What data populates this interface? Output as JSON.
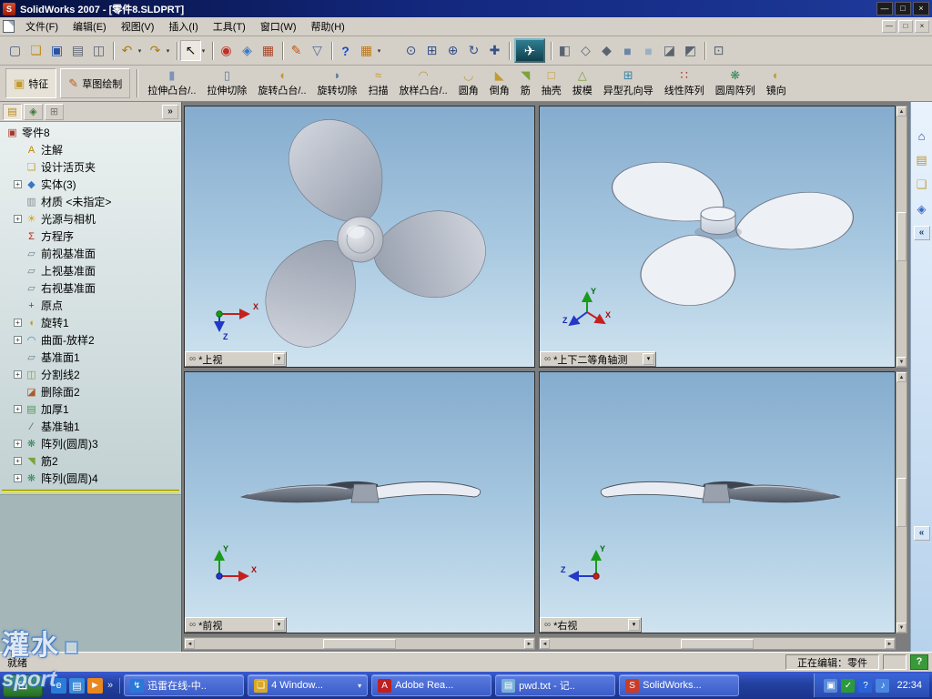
{
  "colors": {
    "titlebar": "#13277d",
    "panel": "#d4d0c8",
    "viewport_top": "#85acce",
    "viewport_bottom": "#cfe3ef",
    "taskbar": "#22409e",
    "rollback": "#ece800"
  },
  "window": {
    "title": "SolidWorks 2007 - [零件8.SLDPRT]",
    "min_glyph": "—",
    "restore_glyph": "□",
    "close_glyph": "×"
  },
  "menu": {
    "items": [
      "文件(F)",
      "编辑(E)",
      "视图(V)",
      "插入(I)",
      "工具(T)",
      "窗口(W)",
      "帮助(H)"
    ]
  },
  "toolbar": {
    "items": [
      {
        "n": "new-document-icon",
        "g": "▢",
        "c": "#46587e"
      },
      {
        "n": "open-folder-icon",
        "g": "❏",
        "c": "#c09020"
      },
      {
        "n": "save-icon",
        "g": "▣",
        "c": "#2a52a8"
      },
      {
        "n": "print-icon",
        "g": "▤",
        "c": "#5a6470"
      },
      {
        "n": "print-preview-icon",
        "g": "◫",
        "c": "#5a6470"
      },
      {
        "n": "toolbar-separator",
        "cls": "sep",
        "inter": "false"
      },
      {
        "n": "undo-icon",
        "g": "↶",
        "c": "#a87e10"
      },
      {
        "n": "dropdown-caret-icon",
        "g": "▾",
        "c": "#333333",
        "cls": "caretbtn"
      },
      {
        "n": "redo-icon",
        "g": "↷",
        "c": "#a87e10"
      },
      {
        "n": "dropdown-caret-icon",
        "g": "▾",
        "c": "#333333",
        "cls": "caretbtn"
      },
      {
        "n": "toolbar-separator",
        "cls": "sep",
        "inter": "false"
      },
      {
        "n": "select-arrow-icon",
        "g": "↖",
        "c": "#101010",
        "cls": "pressed"
      },
      {
        "n": "dropdown-caret-icon",
        "g": "▾",
        "c": "#333333",
        "cls": "caretbtn"
      },
      {
        "n": "toolbar-separator",
        "cls": "sep",
        "inter": "false"
      },
      {
        "n": "rebuild-icon",
        "g": "◉",
        "c": "#c03028"
      },
      {
        "n": "edit-color-icon",
        "g": "◈",
        "c": "#3a7ac0"
      },
      {
        "n": "texture-icon",
        "g": "▦",
        "c": "#a8462a"
      },
      {
        "n": "toolbar-separator",
        "cls": "sep",
        "inter": "false"
      },
      {
        "n": "sketch-icon",
        "g": "✎",
        "c": "#b85a1a"
      },
      {
        "n": "selection-filter-icon",
        "g": "▽",
        "c": "#50689a"
      },
      {
        "n": "toolbar-separator",
        "cls": "sep",
        "inter": "false"
      },
      {
        "n": "help-icon",
        "g": "?",
        "c": "#1a4ac8",
        "cls": "bold"
      },
      {
        "n": "design-table-icon",
        "g": "▦",
        "c": "#c07818"
      },
      {
        "n": "dropdown-caret-icon",
        "g": "▾",
        "c": "#333333",
        "cls": "caretbtn"
      },
      {
        "n": "toolbar-gap",
        "cls": "gap",
        "inter": "false"
      },
      {
        "n": "zoom-to-fit-icon",
        "g": "⊙",
        "c": "#35508a"
      },
      {
        "n": "zoom-area-icon",
        "g": "⊞",
        "c": "#35508a"
      },
      {
        "n": "zoom-in-out-icon",
        "g": "⊕",
        "c": "#35508a"
      },
      {
        "n": "rotate-view-icon",
        "g": "↻",
        "c": "#35508a"
      },
      {
        "n": "pan-icon",
        "g": "✚",
        "c": "#35508a"
      },
      {
        "n": "toolbar-separator",
        "cls": "sep",
        "inter": "false"
      },
      {
        "n": "plugin-button",
        "g": "✈",
        "c": "#ffffff",
        "cls": "plugin"
      },
      {
        "n": "toolbar-separator",
        "cls": "sep",
        "inter": "false"
      },
      {
        "n": "view-orientation-icon",
        "g": "◧",
        "c": "#5a6470"
      },
      {
        "n": "wireframe-icon",
        "g": "◇",
        "c": "#5a6470"
      },
      {
        "n": "hidden-lines-removed-icon",
        "g": "◆",
        "c": "#5a6470"
      },
      {
        "n": "shaded-with-edges-icon",
        "g": "■",
        "c": "#6a86a8"
      },
      {
        "n": "shaded-icon",
        "g": "■",
        "c": "#9ab0c4"
      },
      {
        "n": "shadows-icon",
        "g": "◪",
        "c": "#5a6470"
      },
      {
        "n": "section-view-icon",
        "g": "◩",
        "c": "#5a6470"
      },
      {
        "n": "toolbar-separator",
        "cls": "sep",
        "inter": "false"
      },
      {
        "n": "fullscreen-icon",
        "g": "⊡",
        "c": "#5a6470"
      }
    ]
  },
  "command_manager": {
    "tabs": [
      {
        "label": "特征",
        "icon": "features-tab-icon",
        "g": "▣",
        "c": "#c29a32",
        "cls": "active"
      },
      {
        "label": "草图绘制",
        "icon": "sketch-tab-icon",
        "g": "✎",
        "c": "#b85a1a"
      }
    ],
    "buttons": [
      {
        "label": "拉伸凸台/..",
        "icon": "boss-extrude-icon",
        "g": "▮",
        "c": "#7d94b6"
      },
      {
        "label": "拉伸切除",
        "icon": "cut-extrude-icon",
        "g": "▯",
        "c": "#5c7da0"
      },
      {
        "label": "旋转凸台/..",
        "icon": "revolve-boss-icon",
        "g": "◖",
        "c": "#c29a32"
      },
      {
        "label": "旋转切除",
        "icon": "revolve-cut-icon",
        "g": "◗",
        "c": "#5c7da0"
      },
      {
        "label": "扫描",
        "icon": "sweep-icon",
        "g": "≈",
        "c": "#c29a32"
      },
      {
        "label": "放样凸台/..",
        "icon": "loft-icon",
        "g": "◠",
        "c": "#c29a32"
      },
      {
        "label": "圆角",
        "icon": "fillet-icon",
        "g": "◡",
        "c": "#c29a32"
      },
      {
        "label": "倒角",
        "icon": "chamfer-icon",
        "g": "◣",
        "c": "#c29a32"
      },
      {
        "label": "筋",
        "icon": "rib-icon",
        "g": "◥",
        "c": "#7da23c"
      },
      {
        "label": "抽壳",
        "icon": "shell-icon",
        "g": "□",
        "c": "#c29a32"
      },
      {
        "label": "拔模",
        "icon": "draft-icon",
        "g": "△",
        "c": "#7da23c"
      },
      {
        "label": "异型孔向导",
        "icon": "hole-wizard-icon",
        "g": "⊞",
        "c": "#3a87a8"
      },
      {
        "label": "线性阵列",
        "icon": "linear-pattern-icon",
        "g": "∷",
        "c": "#a03828"
      },
      {
        "label": "圆周阵列",
        "icon": "circular-pattern-icon",
        "g": "❋",
        "c": "#3a8858"
      },
      {
        "label": "镜向",
        "icon": "mirror-icon",
        "g": "◐",
        "c": "#c29a32"
      }
    ]
  },
  "panel": {
    "tabs": [
      {
        "n": "featuremanager-tab",
        "g": "▤",
        "c": "#b8860b",
        "cls": "active"
      },
      {
        "n": "propertymanager-tab",
        "g": "◈",
        "c": "#3a7a3a"
      },
      {
        "n": "configurationmanager-tab",
        "g": "⊞",
        "c": "#777777"
      }
    ],
    "collapse_glyph": "»"
  },
  "feature_tree": {
    "root": "零件8",
    "root_glyph": "▣",
    "items": [
      {
        "label": "注解",
        "icon": "annotations-icon",
        "g": "A",
        "c": "#b8860b"
      },
      {
        "label": "设计活页夹",
        "icon": "design-binder-icon",
        "g": "❏",
        "c": "#c8a23c"
      },
      {
        "label": "实体(3)",
        "icon": "solid-bodies-folder-icon",
        "g": "◆",
        "c": "#3a76c4",
        "exp": "+"
      },
      {
        "label": "材质 <未指定>",
        "icon": "material-icon",
        "g": "▥",
        "c": "#8a8f96"
      },
      {
        "label": "光源与相机",
        "icon": "lights-cameras-icon",
        "g": "☀",
        "c": "#d8a018",
        "exp": "+"
      },
      {
        "label": "方程序",
        "icon": "equations-icon",
        "g": "Σ",
        "c": "#b03020"
      },
      {
        "label": "前视基准面",
        "icon": "front-plane-icon",
        "g": "▱",
        "c": "#6a7f94"
      },
      {
        "label": "上视基准面",
        "icon": "top-plane-icon",
        "g": "▱",
        "c": "#6a7f94"
      },
      {
        "label": "右视基准面",
        "icon": "right-plane-icon",
        "g": "▱",
        "c": "#6a7f94"
      },
      {
        "label": "原点",
        "icon": "origin-icon",
        "g": "+",
        "c": "#2a52c8"
      },
      {
        "label": "旋转1",
        "icon": "revolve-feature-icon",
        "g": "◖",
        "c": "#c29a32",
        "exp": "+"
      },
      {
        "label": "曲面-放样2",
        "icon": "surface-loft-icon",
        "g": "◠",
        "c": "#3a87c8",
        "exp": "+"
      },
      {
        "label": "基准面1",
        "icon": "plane-icon",
        "g": "▱",
        "c": "#6a7f94"
      },
      {
        "label": "分割线2",
        "icon": "split-line-icon",
        "g": "◫",
        "c": "#7da23c",
        "exp": "+"
      },
      {
        "label": "删除面2",
        "icon": "delete-face-icon",
        "g": "◪",
        "c": "#b05a28"
      },
      {
        "label": "加厚1",
        "icon": "thicken-icon",
        "g": "▤",
        "c": "#4a9a4a",
        "exp": "+"
      },
      {
        "label": "基准轴1",
        "icon": "axis-icon",
        "g": "∕",
        "c": "#555555"
      },
      {
        "label": "阵列(圆周)3",
        "icon": "circular-pattern-icon",
        "g": "❋",
        "c": "#3a8858",
        "exp": "+"
      },
      {
        "label": "筋2",
        "icon": "rib-feature-icon",
        "g": "◥",
        "c": "#7da23c",
        "exp": "+"
      },
      {
        "label": "阵列(圆周)4",
        "icon": "circular-pattern-icon",
        "g": "❋",
        "c": "#3a8858",
        "exp": "+"
      }
    ]
  },
  "viewport_ui": {
    "link": "∞",
    "dd": "▾"
  },
  "viewports": [
    {
      "label": "*上视"
    },
    {
      "label": "*上下二等角轴测"
    },
    {
      "label": "*前视"
    },
    {
      "label": "*右视"
    }
  ],
  "scrollbar": {
    "up": "▲",
    "down": "▼",
    "left": "◄",
    "right": "►"
  },
  "taskpane": {
    "icons": [
      {
        "n": "home-icon",
        "g": "⌂",
        "c": "#2a4a9a"
      },
      {
        "n": "design-library-icon",
        "g": "▤",
        "c": "#c8922a"
      },
      {
        "n": "file-explorer-icon",
        "g": "❏",
        "c": "#c8a23c"
      },
      {
        "n": "solidworks-resources-icon",
        "g": "◈",
        "c": "#3a6ac8"
      }
    ],
    "collapse_glyph": "«"
  },
  "statusbar": {
    "ready": "就绪",
    "editing": "正在编辑：零件",
    "help_glyph": "?"
  },
  "watermark": {
    "line1": "灌水",
    "line2": "sport"
  },
  "taskbar": {
    "start_glyph": "⊞",
    "overflow_glyph": "»",
    "quicklaunch": [
      {
        "n": "internet-explorer-icon",
        "g": "e",
        "c": "#2b7cd8"
      },
      {
        "n": "show-desktop-icon",
        "g": "▤",
        "c": "#3a8ad8"
      },
      {
        "n": "media-player-icon",
        "g": "►",
        "c": "#e88820"
      }
    ],
    "buttons": [
      {
        "label": "迅雷在线-中..",
        "icon": "thunder-task-icon",
        "g": "↯",
        "c": "#2878d8"
      },
      {
        "label": "4 Window...",
        "icon": "explorer-group-task-icon",
        "g": "❏",
        "c": "#d8a828",
        "caret": "▾"
      },
      {
        "label": "Adobe Rea...",
        "icon": "adobe-reader-task-icon",
        "g": "A",
        "c": "#c02020"
      },
      {
        "label": "pwd.txt - 记..",
        "icon": "notepad-task-icon",
        "g": "▤",
        "c": "#7ab0d8"
      },
      {
        "label": "SolidWorks...",
        "icon": "solidworks-task-icon",
        "g": "S",
        "c": "#c83c28"
      }
    ],
    "tray": [
      {
        "n": "app-tray-icon",
        "g": "▣",
        "c": "#5a8ad8"
      },
      {
        "n": "antivirus-tray-icon",
        "g": "✓",
        "c": "#2a9a3a"
      },
      {
        "n": "security-alert-tray-icon",
        "g": "?",
        "c": "#2a62d8"
      },
      {
        "n": "volume-tray-icon",
        "g": "♪",
        "c": "#4a86e0"
      }
    ],
    "clock": "22:34"
  }
}
